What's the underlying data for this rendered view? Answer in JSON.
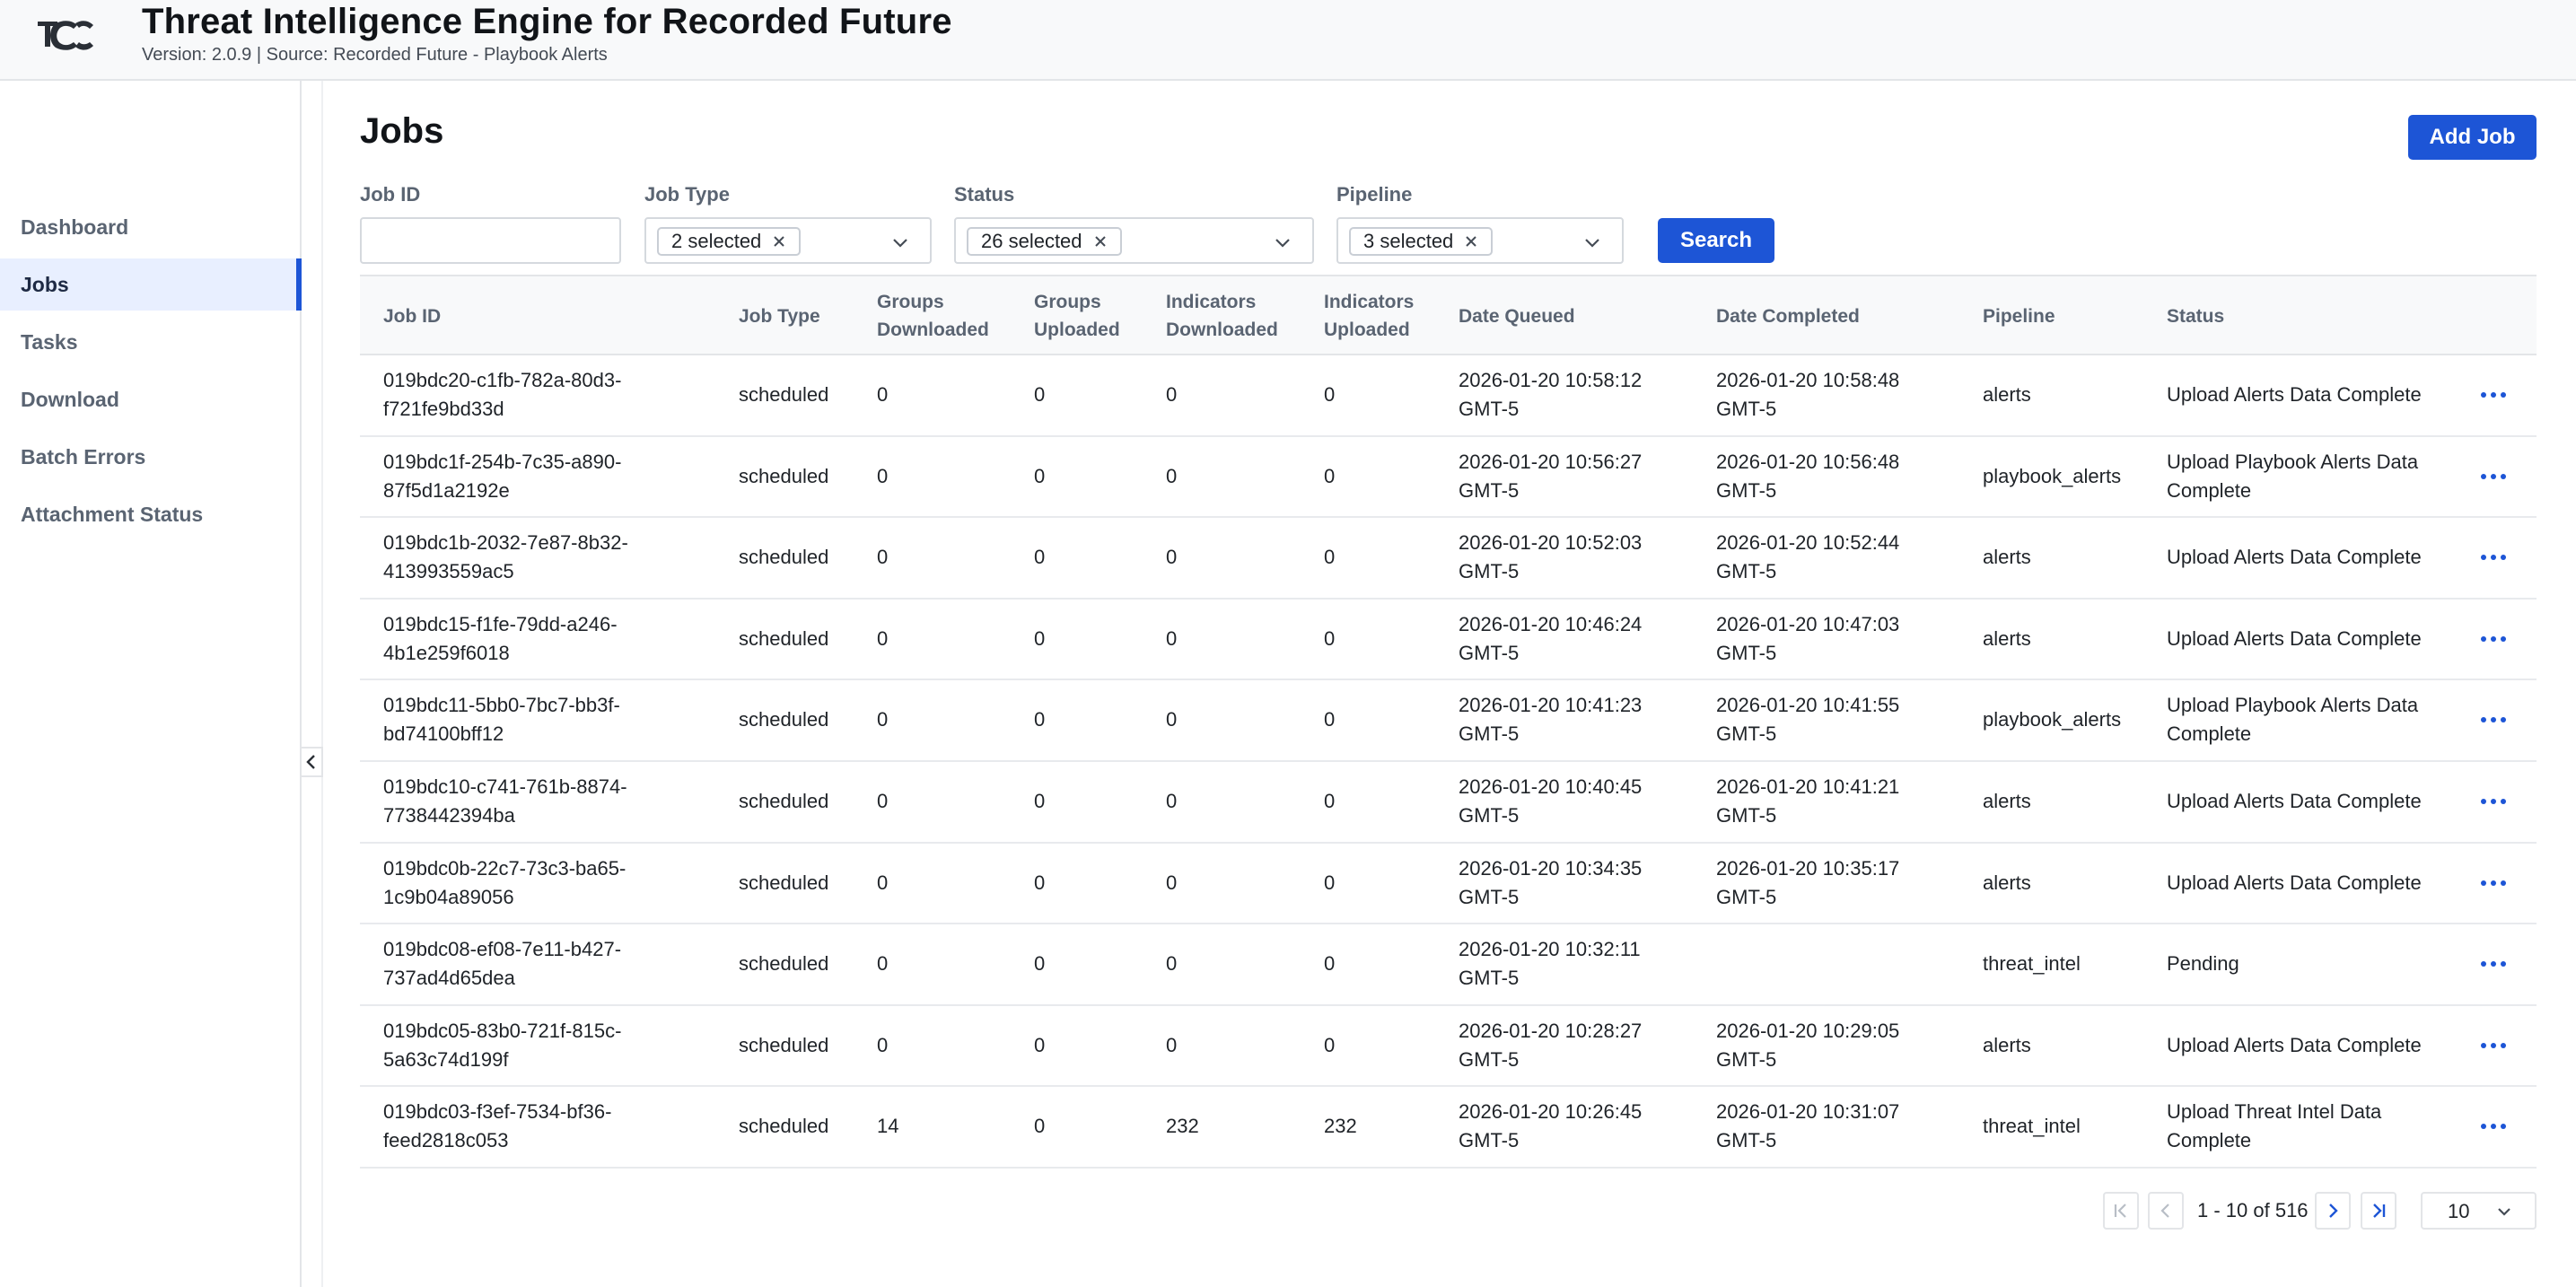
{
  "app": {
    "title": "Threat Intelligence Engine for Recorded Future",
    "subtitle": "Version: 2.0.9 | Source: Recorded Future - Playbook Alerts"
  },
  "sidebar": {
    "items": [
      {
        "label": "Dashboard",
        "active": false
      },
      {
        "label": "Jobs",
        "active": true
      },
      {
        "label": "Tasks",
        "active": false
      },
      {
        "label": "Download",
        "active": false
      },
      {
        "label": "Batch Errors",
        "active": false
      },
      {
        "label": "Attachment Status",
        "active": false
      }
    ]
  },
  "page": {
    "title": "Jobs",
    "add_job_label": "Add Job"
  },
  "filters": {
    "job_id": {
      "label": "Job ID",
      "value": ""
    },
    "job_type": {
      "label": "Job Type",
      "chip": "2 selected"
    },
    "status": {
      "label": "Status",
      "chip": "26 selected"
    },
    "pipeline": {
      "label": "Pipeline",
      "chip": "3 selected"
    },
    "search_label": "Search"
  },
  "table": {
    "headers": [
      "Job ID",
      "Job Type",
      "Groups Downloaded",
      "Groups Uploaded",
      "Indicators Downloaded",
      "Indicators Uploaded",
      "Date Queued",
      "Date Completed",
      "Pipeline",
      "Status"
    ],
    "rows": [
      {
        "id": [
          "019bdc20-c1fb-782a-80d3-",
          "f721fe9bd33d"
        ],
        "type": "scheduled",
        "gd": "0",
        "gu": "0",
        "id_dl": "0",
        "iu": "0",
        "queued": [
          "2026-01-20 10:58:12",
          "GMT-5"
        ],
        "completed": [
          "2026-01-20 10:58:48",
          "GMT-5"
        ],
        "pipeline": "alerts",
        "status": [
          "Upload Alerts Data Complete"
        ]
      },
      {
        "id": [
          "019bdc1f-254b-7c35-a890-",
          "87f5d1a2192e"
        ],
        "type": "scheduled",
        "gd": "0",
        "gu": "0",
        "id_dl": "0",
        "iu": "0",
        "queued": [
          "2026-01-20 10:56:27",
          "GMT-5"
        ],
        "completed": [
          "2026-01-20 10:56:48",
          "GMT-5"
        ],
        "pipeline": "playbook_alerts",
        "status": [
          "Upload Playbook Alerts Data",
          "Complete"
        ]
      },
      {
        "id": [
          "019bdc1b-2032-7e87-8b32-",
          "413993559ac5"
        ],
        "type": "scheduled",
        "gd": "0",
        "gu": "0",
        "id_dl": "0",
        "iu": "0",
        "queued": [
          "2026-01-20 10:52:03",
          "GMT-5"
        ],
        "completed": [
          "2026-01-20 10:52:44",
          "GMT-5"
        ],
        "pipeline": "alerts",
        "status": [
          "Upload Alerts Data Complete"
        ]
      },
      {
        "id": [
          "019bdc15-f1fe-79dd-a246-",
          "4b1e259f6018"
        ],
        "type": "scheduled",
        "gd": "0",
        "gu": "0",
        "id_dl": "0",
        "iu": "0",
        "queued": [
          "2026-01-20 10:46:24",
          "GMT-5"
        ],
        "completed": [
          "2026-01-20 10:47:03",
          "GMT-5"
        ],
        "pipeline": "alerts",
        "status": [
          "Upload Alerts Data Complete"
        ]
      },
      {
        "id": [
          "019bdc11-5bb0-7bc7-bb3f-",
          "bd74100bff12"
        ],
        "type": "scheduled",
        "gd": "0",
        "gu": "0",
        "id_dl": "0",
        "iu": "0",
        "queued": [
          "2026-01-20 10:41:23",
          "GMT-5"
        ],
        "completed": [
          "2026-01-20 10:41:55",
          "GMT-5"
        ],
        "pipeline": "playbook_alerts",
        "status": [
          "Upload Playbook Alerts Data",
          "Complete"
        ]
      },
      {
        "id": [
          "019bdc10-c741-761b-8874-",
          "7738442394ba"
        ],
        "type": "scheduled",
        "gd": "0",
        "gu": "0",
        "id_dl": "0",
        "iu": "0",
        "queued": [
          "2026-01-20 10:40:45",
          "GMT-5"
        ],
        "completed": [
          "2026-01-20 10:41:21",
          "GMT-5"
        ],
        "pipeline": "alerts",
        "status": [
          "Upload Alerts Data Complete"
        ]
      },
      {
        "id": [
          "019bdc0b-22c7-73c3-ba65-",
          "1c9b04a89056"
        ],
        "type": "scheduled",
        "gd": "0",
        "gu": "0",
        "id_dl": "0",
        "iu": "0",
        "queued": [
          "2026-01-20 10:34:35",
          "GMT-5"
        ],
        "completed": [
          "2026-01-20 10:35:17",
          "GMT-5"
        ],
        "pipeline": "alerts",
        "status": [
          "Upload Alerts Data Complete"
        ]
      },
      {
        "id": [
          "019bdc08-ef08-7e11-b427-",
          "737ad4d65dea"
        ],
        "type": "scheduled",
        "gd": "0",
        "gu": "0",
        "id_dl": "0",
        "iu": "0",
        "queued": [
          "2026-01-20 10:32:11",
          "GMT-5"
        ],
        "completed": [],
        "pipeline": "threat_intel",
        "status": [
          "Pending"
        ]
      },
      {
        "id": [
          "019bdc05-83b0-721f-815c-",
          "5a63c74d199f"
        ],
        "type": "scheduled",
        "gd": "0",
        "gu": "0",
        "id_dl": "0",
        "iu": "0",
        "queued": [
          "2026-01-20 10:28:27",
          "GMT-5"
        ],
        "completed": [
          "2026-01-20 10:29:05",
          "GMT-5"
        ],
        "pipeline": "alerts",
        "status": [
          "Upload Alerts Data Complete"
        ]
      },
      {
        "id": [
          "019bdc03-f3ef-7534-bf36-",
          "feed2818c053"
        ],
        "type": "scheduled",
        "gd": "14",
        "gu": "0",
        "id_dl": "232",
        "iu": "232",
        "queued": [
          "2026-01-20 10:26:45",
          "GMT-5"
        ],
        "completed": [
          "2026-01-20 10:31:07",
          "GMT-5"
        ],
        "pipeline": "threat_intel",
        "status": [
          "Upload Threat Intel Data",
          "Complete"
        ]
      }
    ]
  },
  "pagination": {
    "info": "1 - 10 of 516",
    "page_size": "10"
  },
  "colors": {
    "primary": "#1d55d6",
    "active_nav_bg": "#e8efff",
    "header_bg": "#f8f9fa"
  }
}
